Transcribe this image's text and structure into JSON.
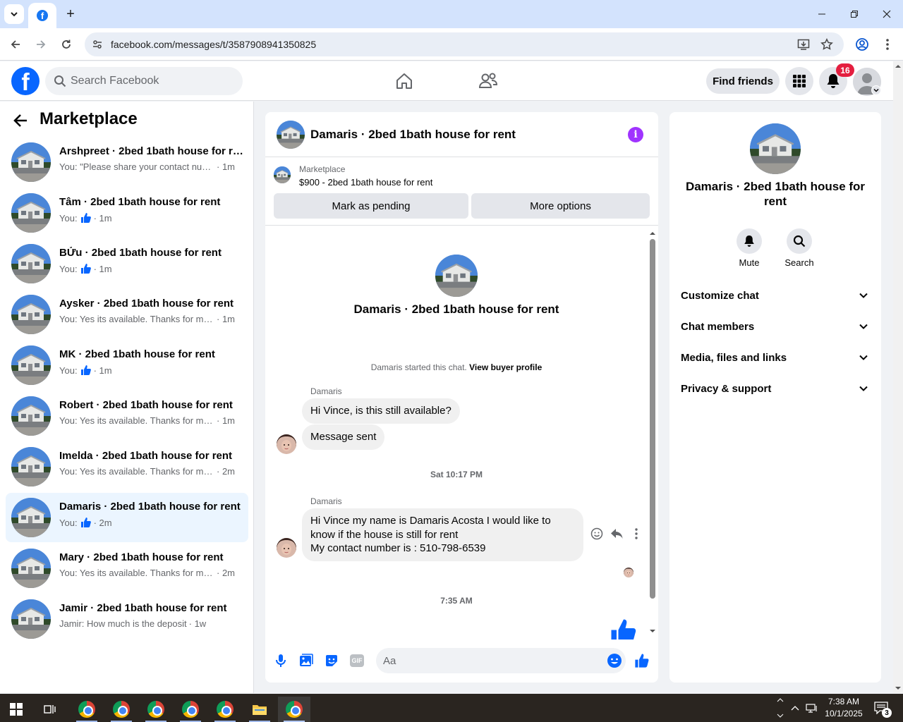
{
  "browser": {
    "url": "facebook.com/messages/t/3587908941350825",
    "new_tab_label": "+",
    "favicon_letter": "f"
  },
  "fb": {
    "logo_letter": "f",
    "search_placeholder": "Search Facebook",
    "find_friends": "Find friends",
    "notifications_count": "16"
  },
  "left": {
    "title": "Marketplace",
    "conversations": [
      {
        "name": "Arshpreet · 2bed 1bath house for rent",
        "snippet": "You: \"Please share your contact num...",
        "time": "· 1m",
        "like": false,
        "active": false
      },
      {
        "name": "Tâm · 2bed 1bath house for rent",
        "snippet": "You:",
        "time": "· 1m",
        "like": true,
        "active": false
      },
      {
        "name": "BỬu · 2bed 1bath house for rent",
        "snippet": "You:",
        "time": "· 1m",
        "like": true,
        "active": false
      },
      {
        "name": "Aysker · 2bed 1bath house for rent",
        "snippet": "You: Yes its available. Thanks for mess...",
        "time": "· 1m",
        "like": false,
        "active": false
      },
      {
        "name": "MK · 2bed 1bath house for rent",
        "snippet": "You:",
        "time": "· 1m",
        "like": true,
        "active": false
      },
      {
        "name": "Robert · 2bed 1bath house for rent",
        "snippet": "You: Yes its available. Thanks for mess...",
        "time": "· 1m",
        "like": false,
        "active": false
      },
      {
        "name": "Imelda · 2bed 1bath house for rent",
        "snippet": "You: Yes its available. Thanks for mess...",
        "time": "· 2m",
        "like": false,
        "active": false
      },
      {
        "name": "Damaris · 2bed 1bath house for rent",
        "snippet": "You:",
        "time": "· 2m",
        "like": true,
        "active": true
      },
      {
        "name": "Mary · 2bed 1bath house for rent",
        "snippet": "You: Yes its available. Thanks for mess...",
        "time": "· 2m",
        "like": false,
        "active": false
      },
      {
        "name": "Jamir · 2bed 1bath house for rent",
        "snippet": "Jamir: How much is the deposit",
        "time": "· 1w",
        "like": false,
        "active": false
      }
    ]
  },
  "chat": {
    "title": "Damaris · 2bed 1bath house for rent",
    "listing_label": "Marketplace",
    "listing_price": "$900 - 2bed 1bath house for rent",
    "mark_pending": "Mark as pending",
    "more_options": "More options",
    "thread_title": "Damaris · 2bed 1bath house for rent",
    "system_text": "Damaris started this chat.",
    "system_link": "View buyer profile",
    "sender1": "Damaris",
    "msg1": "Hi Vince, is this still available?",
    "msg2": "Message sent",
    "ts1": "Sat 10:17 PM",
    "sender2": "Damaris",
    "msg3_line1": "Hi Vince my name is Damaris Acosta I would like to",
    "msg3_line2": "know if the house is still for rent",
    "msg3_line3": "My contact number is : 510-798-6539",
    "ts2": "7:35 AM",
    "composer_placeholder": "Aa",
    "gif_label": "GIF"
  },
  "right": {
    "title": "Damaris · 2bed 1bath house for rent",
    "mute": "Mute",
    "search": "Search",
    "rows": [
      "Customize chat",
      "Chat members",
      "Media, files and links",
      "Privacy & support"
    ]
  },
  "taskbar": {
    "time": "7:38 AM",
    "date": "10/1/2025",
    "notif_count": "3"
  }
}
